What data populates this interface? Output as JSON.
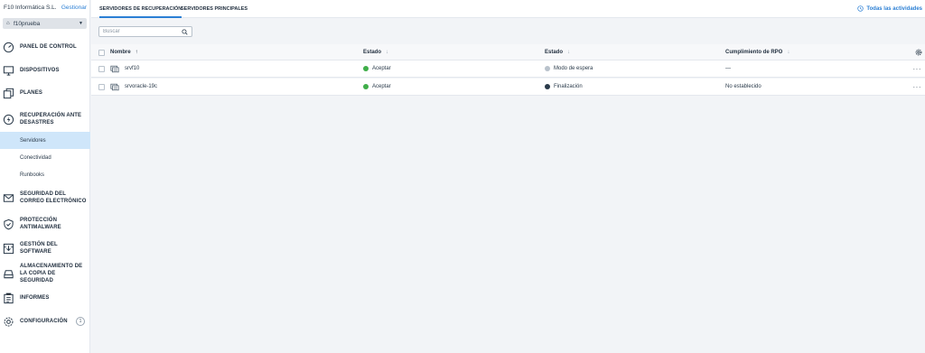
{
  "sidebar": {
    "org_name": "F10 Informática S.L.",
    "manage_link": "Gestionar",
    "tenant": "f10prueba",
    "items": [
      {
        "label": "PANEL DE CONTROL",
        "icon": "dashboard-icon"
      },
      {
        "label": "DISPOSITIVOS",
        "icon": "monitor-icon"
      },
      {
        "label": "PLANES",
        "icon": "plans-icon"
      },
      {
        "label": "RECUPERACIÓN ANTE DESASTRES",
        "icon": "lightning-icon"
      },
      {
        "label": "SEGURIDAD DEL CORREO ELECTRÓNICO",
        "icon": "envelope-icon"
      },
      {
        "label": "PROTECCIÓN ANTIMALWARE",
        "icon": "shield-icon"
      },
      {
        "label": "GESTIÓN DEL SOFTWARE",
        "icon": "software-icon"
      },
      {
        "label": "ALMACENAMIENTO DE LA COPIA DE SEGURIDAD",
        "icon": "storage-icon"
      },
      {
        "label": "INFORMES",
        "icon": "reports-icon"
      },
      {
        "label": "CONFIGURACIÓN",
        "icon": "gear-icon",
        "badge": "1"
      }
    ],
    "sub_items": [
      {
        "label": "Servidores",
        "active": true
      },
      {
        "label": "Conectividad",
        "active": false
      },
      {
        "label": "Runbooks",
        "active": false
      }
    ]
  },
  "tabs": [
    {
      "label": "SERVIDORES DE RECUPERACIÓN",
      "active": true
    },
    {
      "label": "SERVIDORES PRINCIPALES",
      "active": false
    }
  ],
  "activities_label": "Todas las actividades",
  "search": {
    "placeholder": "Buscar",
    "value": ""
  },
  "table": {
    "columns": [
      "Nombre",
      "Estado",
      "Estado",
      "Cumplimiento de RPO"
    ],
    "rows": [
      {
        "name": "srvf10",
        "status": "Aceptar",
        "state": "Modo de espera",
        "rpo": "—"
      },
      {
        "name": "srvoracle-19c",
        "status": "Aceptar",
        "state": "Finalización",
        "rpo": "No establecido"
      }
    ]
  },
  "colors": {
    "accent": "#2b7fd4",
    "ok": "#3fae49",
    "active_bg": "#cfe6fa"
  }
}
